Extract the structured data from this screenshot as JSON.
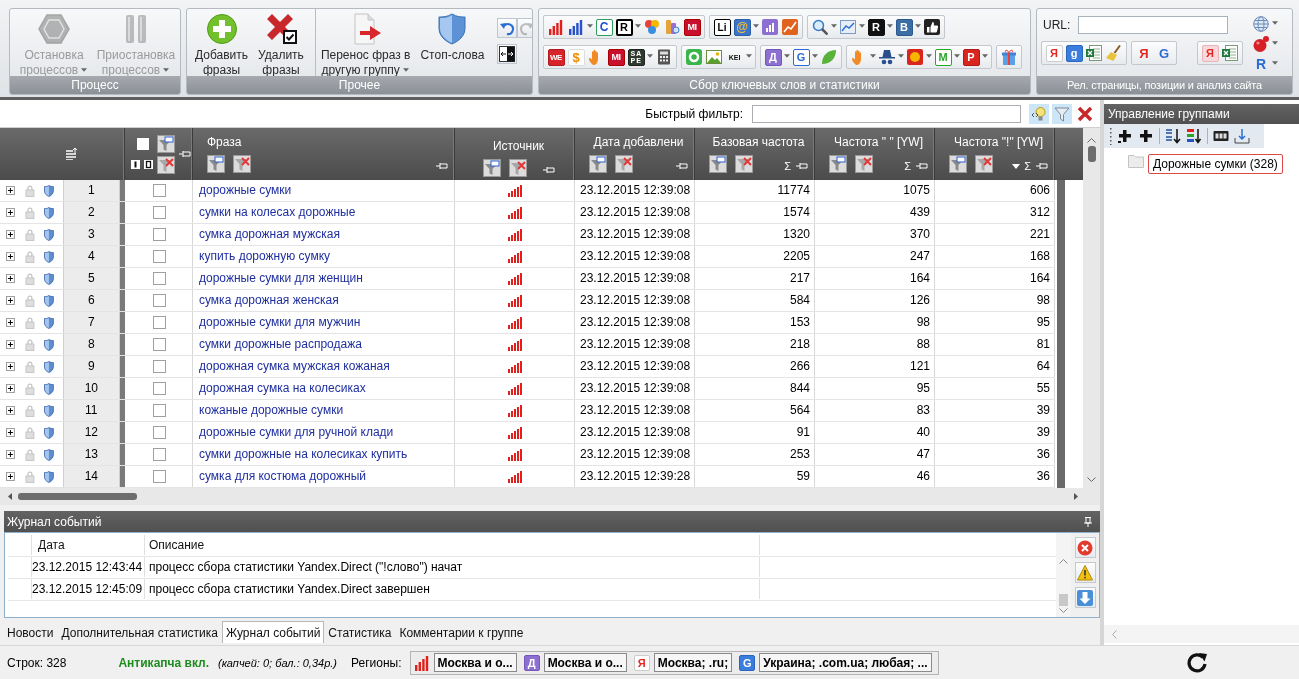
{
  "ribbon": {
    "process": {
      "label": "Процесс",
      "buttons": [
        {
          "label": "Остановка\nпроцессов",
          "dropdown": true,
          "disabled": true
        },
        {
          "label": "Приостановка\nпроцессов",
          "dropdown": true,
          "disabled": true
        }
      ]
    },
    "misc": {
      "label": "Прочее",
      "buttons": [
        {
          "label": "Добавить\nфразы",
          "dropdown": false,
          "disabled": false
        },
        {
          "label": "Удалить\nфразы",
          "dropdown": false,
          "disabled": false
        },
        {
          "label": "Перенос фраз в\nдругую группу",
          "dropdown": true,
          "disabled": false
        },
        {
          "label": "Стоп-слова",
          "dropdown": false,
          "disabled": false
        }
      ],
      "small_buttons": [
        {
          "disabled": false
        },
        {
          "disabled": true
        },
        {
          "disabled": false
        }
      ]
    },
    "keywords": {
      "label": "Сбор ключевых слов и статистики",
      "rows": [
        [
          [
            {
              "dropdown": false
            },
            {
              "dropdown": true
            },
            {
              "glyph": "C",
              "dropdown": false
            },
            {
              "glyph": "R",
              "dropdown": true
            },
            {
              "dropdown": false
            },
            {
              "dropdown": false
            },
            {
              "glyph": "MI",
              "dropdown": false
            }
          ],
          [
            {
              "glyph": "Li",
              "dropdown": false
            },
            {
              "glyph": "@",
              "dropdown": true
            },
            {
              "dropdown": false
            },
            {
              "dropdown": false
            }
          ],
          [
            {
              "dropdown": true
            },
            {
              "dropdown": true
            },
            {
              "glyph": "R",
              "dropdown": true
            },
            {
              "glyph": "B",
              "dropdown": true
            },
            {
              "dropdown": false
            }
          ]
        ],
        [
          [
            {
              "glyph": "WE",
              "dropdown": false
            },
            {
              "glyph": "$",
              "dropdown": false
            },
            {
              "dropdown": false
            },
            {
              "glyph": "MI",
              "dropdown": false
            },
            {
              "glyph": "SAPE",
              "dropdown": true
            },
            {
              "dropdown": false
            }
          ],
          [
            {
              "dropdown": false
            },
            {
              "dropdown": false
            },
            {
              "glyph": "KEI",
              "dropdown": true
            }
          ],
          [
            {
              "glyph": "Д",
              "dropdown": true
            },
            {
              "glyph": "G",
              "dropdown": true
            },
            {
              "dropdown": false
            }
          ],
          [
            {
              "dropdown": true
            },
            {
              "dropdown": true
            },
            {
              "dropdown": true
            },
            {
              "glyph": "M",
              "dropdown": true
            },
            {
              "glyph": "P",
              "dropdown": true
            }
          ],
          [
            {
              "dropdown": false
            }
          ]
        ]
      ]
    },
    "site": {
      "label": "Рел. страницы, позиции и анализ сайта",
      "url_label": "URL:",
      "side_tools": [
        {
          "dropdown": true
        },
        {
          "dropdown": true
        },
        {
          "glyph": "R",
          "dropdown": true
        }
      ],
      "tools": [
        [
          {
            "glyph": "Я",
            "dropdown": false
          },
          {
            "glyph": "g",
            "dropdown": false
          },
          {
            "dropdown": false
          },
          {
            "dropdown": false
          }
        ],
        [
          {
            "glyph": "Я",
            "dropdown": false
          },
          {
            "glyph": "G",
            "dropdown": false
          }
        ],
        [
          {
            "glyph": "Я",
            "dropdown": false
          },
          {
            "dropdown": false
          }
        ]
      ]
    }
  },
  "quick_filter": {
    "label": "Быстрый фильтр:"
  },
  "table": {
    "select_all": {
      "checked": false
    },
    "columns": [
      {
        "title": "Фраза",
        "sorted": false
      },
      {
        "title": "Источник",
        "sorted": false
      },
      {
        "title": "Дата добавлени",
        "sorted": false
      },
      {
        "title": "Базовая частота",
        "summary": "Σ",
        "sorted": false
      },
      {
        "title": "Частота \" \" [YW]",
        "summary": "Σ",
        "sorted": false
      },
      {
        "title": "Частота \"!\" [YW]",
        "summary": "Σ",
        "sorted": true
      }
    ],
    "rows": [
      {
        "number": "1",
        "expanded": false,
        "checked": false,
        "phrase": "дорожные сумки",
        "date": "23.12.2015 12:39:08",
        "base": "11774",
        "freq_quotes": "1075",
        "freq_exact": "606"
      },
      {
        "number": "2",
        "expanded": false,
        "checked": false,
        "phrase": "сумки на колесах дорожные",
        "date": "23.12.2015 12:39:08",
        "base": "1574",
        "freq_quotes": "439",
        "freq_exact": "312"
      },
      {
        "number": "3",
        "expanded": false,
        "checked": false,
        "phrase": "сумка дорожная мужская",
        "date": "23.12.2015 12:39:08",
        "base": "1320",
        "freq_quotes": "370",
        "freq_exact": "221"
      },
      {
        "number": "4",
        "expanded": false,
        "checked": false,
        "phrase": "купить дорожную сумку",
        "date": "23.12.2015 12:39:08",
        "base": "2205",
        "freq_quotes": "247",
        "freq_exact": "168"
      },
      {
        "number": "5",
        "expanded": false,
        "checked": false,
        "phrase": "дорожные сумки для женщин",
        "date": "23.12.2015 12:39:08",
        "base": "217",
        "freq_quotes": "164",
        "freq_exact": "164"
      },
      {
        "number": "6",
        "expanded": false,
        "checked": false,
        "phrase": "сумка дорожная женская",
        "date": "23.12.2015 12:39:08",
        "base": "584",
        "freq_quotes": "126",
        "freq_exact": "98"
      },
      {
        "number": "7",
        "expanded": false,
        "checked": false,
        "phrase": "дорожные сумки для мужчин",
        "date": "23.12.2015 12:39:08",
        "base": "153",
        "freq_quotes": "98",
        "freq_exact": "95"
      },
      {
        "number": "8",
        "expanded": false,
        "checked": false,
        "phrase": "сумки дорожные распродажа",
        "date": "23.12.2015 12:39:08",
        "base": "218",
        "freq_quotes": "88",
        "freq_exact": "81"
      },
      {
        "number": "9",
        "expanded": false,
        "checked": false,
        "phrase": "дорожная сумка мужская кожаная",
        "date": "23.12.2015 12:39:08",
        "base": "266",
        "freq_quotes": "121",
        "freq_exact": "64"
      },
      {
        "number": "10",
        "expanded": false,
        "checked": false,
        "phrase": "дорожная сумка на колесиках",
        "date": "23.12.2015 12:39:08",
        "base": "844",
        "freq_quotes": "95",
        "freq_exact": "55"
      },
      {
        "number": "11",
        "expanded": false,
        "checked": false,
        "phrase": "кожаные дорожные сумки",
        "date": "23.12.2015 12:39:08",
        "base": "564",
        "freq_quotes": "83",
        "freq_exact": "39"
      },
      {
        "number": "12",
        "expanded": false,
        "checked": false,
        "phrase": "дорожные сумки для ручной клади",
        "date": "23.12.2015 12:39:08",
        "base": "91",
        "freq_quotes": "40",
        "freq_exact": "39"
      },
      {
        "number": "13",
        "expanded": false,
        "checked": false,
        "phrase": "сумки дорожные на колесиках купить",
        "date": "23.12.2015 12:39:08",
        "base": "253",
        "freq_quotes": "47",
        "freq_exact": "36"
      },
      {
        "number": "14",
        "expanded": false,
        "checked": false,
        "phrase": "сумка для костюма дорожный",
        "date": "23.12.2015 12:39:28",
        "base": "59",
        "freq_quotes": "46",
        "freq_exact": "36"
      }
    ]
  },
  "event_log": {
    "title": "Журнал событий",
    "columns": [
      "Дата",
      "Описание"
    ],
    "rows": [
      {
        "date": "23.12.2015 12:43:44",
        "description": "процесс сбора статистики Yandex.Direct (\"!слово\") начат"
      },
      {
        "date": "23.12.2015 12:45:09",
        "description": "процесс сбора статистики Yandex.Direct завершен"
      }
    ]
  },
  "bottom_tabs": [
    {
      "label": "Новости",
      "selected": false
    },
    {
      "label": "Дополнительная статистика",
      "selected": false
    },
    {
      "label": "Журнал событий",
      "selected": true
    },
    {
      "label": "Статистика",
      "selected": false
    },
    {
      "label": "Комментарии к группе",
      "selected": false
    }
  ],
  "groups_panel": {
    "title": "Управление группами",
    "tree": [
      {
        "label": "Дорожные сумки (328)",
        "selected": true
      }
    ]
  },
  "status_bar": {
    "rows_count": "Строк: 328",
    "anticaptcha": "Антикапча вкл.",
    "anticaptcha_details": "(капчей: 0; бал.: 0,34р.)",
    "regions_label": "Регионы:",
    "regions": [
      {
        "text": "Москва и о..."
      },
      {
        "glyph": "Д",
        "text": "Москва и о..."
      },
      {
        "glyph": "Я",
        "text": "Москва; .ru;"
      },
      {
        "glyph": "G",
        "text": "Украина; .com.ua; любая; ..."
      }
    ]
  }
}
